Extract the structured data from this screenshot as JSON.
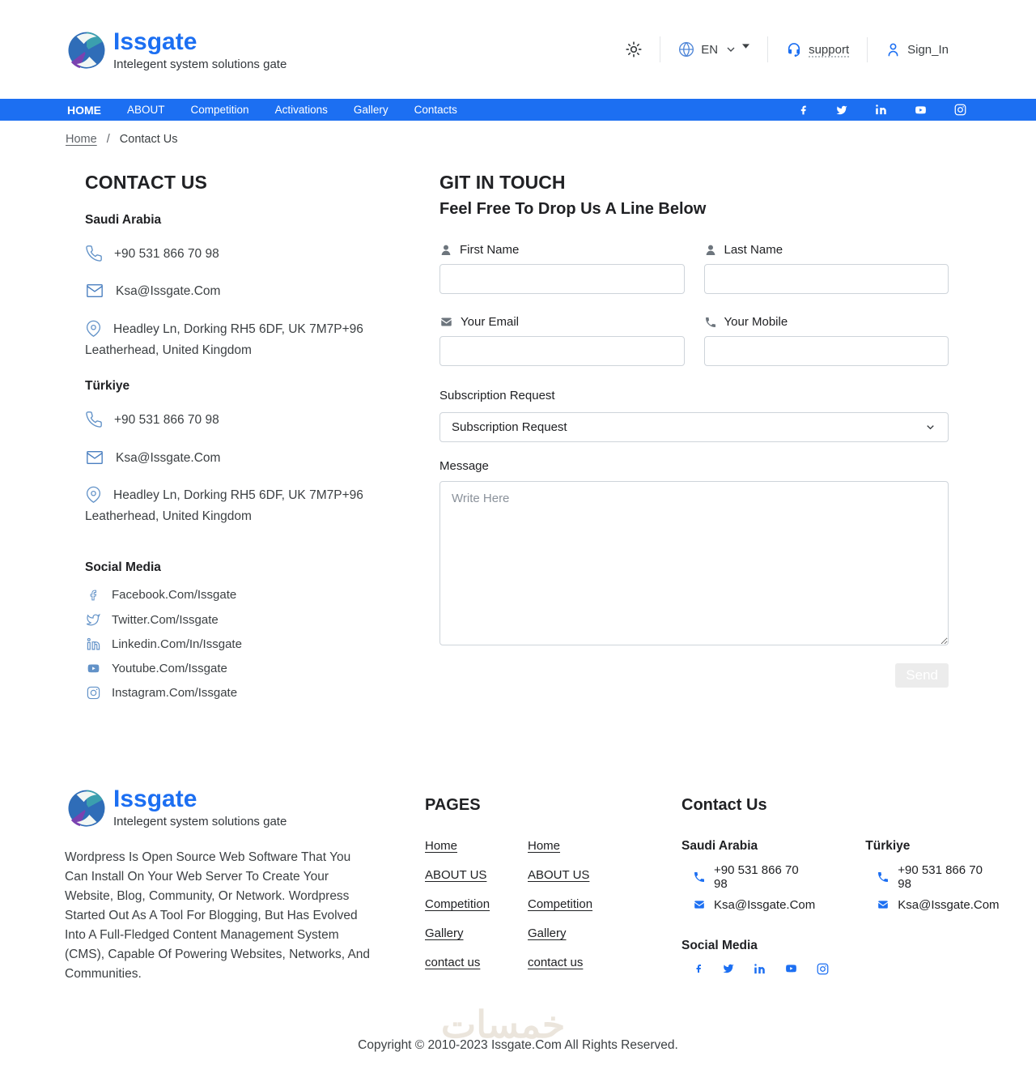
{
  "header": {
    "brand": {
      "name": "Issgate",
      "tagline": "Intelegent system solutions gate"
    },
    "language": "EN",
    "support_label": "support",
    "signin_label": "Sign_In"
  },
  "nav": {
    "items": [
      "HOME",
      "ABOUT",
      "Competition",
      "Activations",
      "Gallery",
      "Contacts"
    ]
  },
  "breadcrumb": {
    "home": "Home",
    "separator": "/",
    "current": "Contact Us"
  },
  "contact": {
    "title": "CONTACT US",
    "locations": [
      {
        "name": "Saudi Arabia",
        "phone": "+90 531 866 70 98",
        "email": "Ksa@Issgate.Com",
        "address": "Headley Ln, Dorking RH5 6DF, UK 7M7P+96 Leatherhead, United Kingdom"
      },
      {
        "name": "Türkiye",
        "phone": "+90 531 866 70 98",
        "email": "Ksa@Issgate.Com",
        "address": "Headley Ln, Dorking RH5 6DF, UK 7M7P+96 Leatherhead, United Kingdom"
      }
    ],
    "social": {
      "title": "Social Media",
      "items": [
        {
          "icon": "facebook-icon",
          "label": "Facebook.Com/Issgate"
        },
        {
          "icon": "twitter-icon",
          "label": "Twitter.Com/Issgate"
        },
        {
          "icon": "linkedin-icon",
          "label": "Linkedin.Com/In/Issgate"
        },
        {
          "icon": "youtube-icon",
          "label": "Youtube.Com/Issgate"
        },
        {
          "icon": "instagram-icon",
          "label": "Instagram.Com/Issgate"
        }
      ]
    }
  },
  "form": {
    "title": "GIT IN TOUCH",
    "subtitle": "Feel Free To Drop Us A Line Below",
    "first_name_label": "First Name",
    "last_name_label": "Last Name",
    "email_label": "Your Email",
    "mobile_label": "Your Mobile",
    "subscription_label": "Subscription Request",
    "subscription_value": "Subscription Request",
    "message_label": "Message",
    "message_placeholder": "Write Here",
    "send_label": "Send"
  },
  "footer": {
    "description": "Wordpress Is Open Source Web Software That You Can Install On Your Web Server To Create Your Website, Blog, Community, Or Network. Wordpress Started Out As A Tool For Blogging, But Has Evolved Into A Full-Fledged Content Management System (CMS), Capable Of Powering Websites, Networks, And Communities.",
    "pages": {
      "title": "PAGES",
      "links": [
        "Home",
        "ABOUT US",
        "Competition",
        "Gallery",
        "contact us"
      ]
    },
    "contact": {
      "title": "Contact Us",
      "locations": [
        {
          "name": "Saudi Arabia",
          "phone": "+90 531 866 70 98",
          "email": "Ksa@Issgate.Com"
        },
        {
          "name": "Türkiye",
          "phone": "+90 531 866 70 98",
          "email": "Ksa@Issgate.Com"
        }
      ],
      "social_title": "Social Media"
    },
    "copyright": "Copyright © 2010-2023 Issgate.Com All Rights Reserved.",
    "watermark": "خمسات"
  },
  "colors": {
    "accent_blue": "#1c6ff2",
    "steel_icon_blue": "#6292c8",
    "send_button_bg": "#ececec"
  },
  "icons": [
    "sun-icon",
    "globe-icon",
    "chevron-down-icon",
    "caret-icon",
    "headset-icon",
    "user-icon",
    "facebook-icon",
    "twitter-icon",
    "linkedin-icon",
    "youtube-icon",
    "instagram-icon",
    "phone-icon",
    "mail-icon",
    "map-pin-icon"
  ]
}
